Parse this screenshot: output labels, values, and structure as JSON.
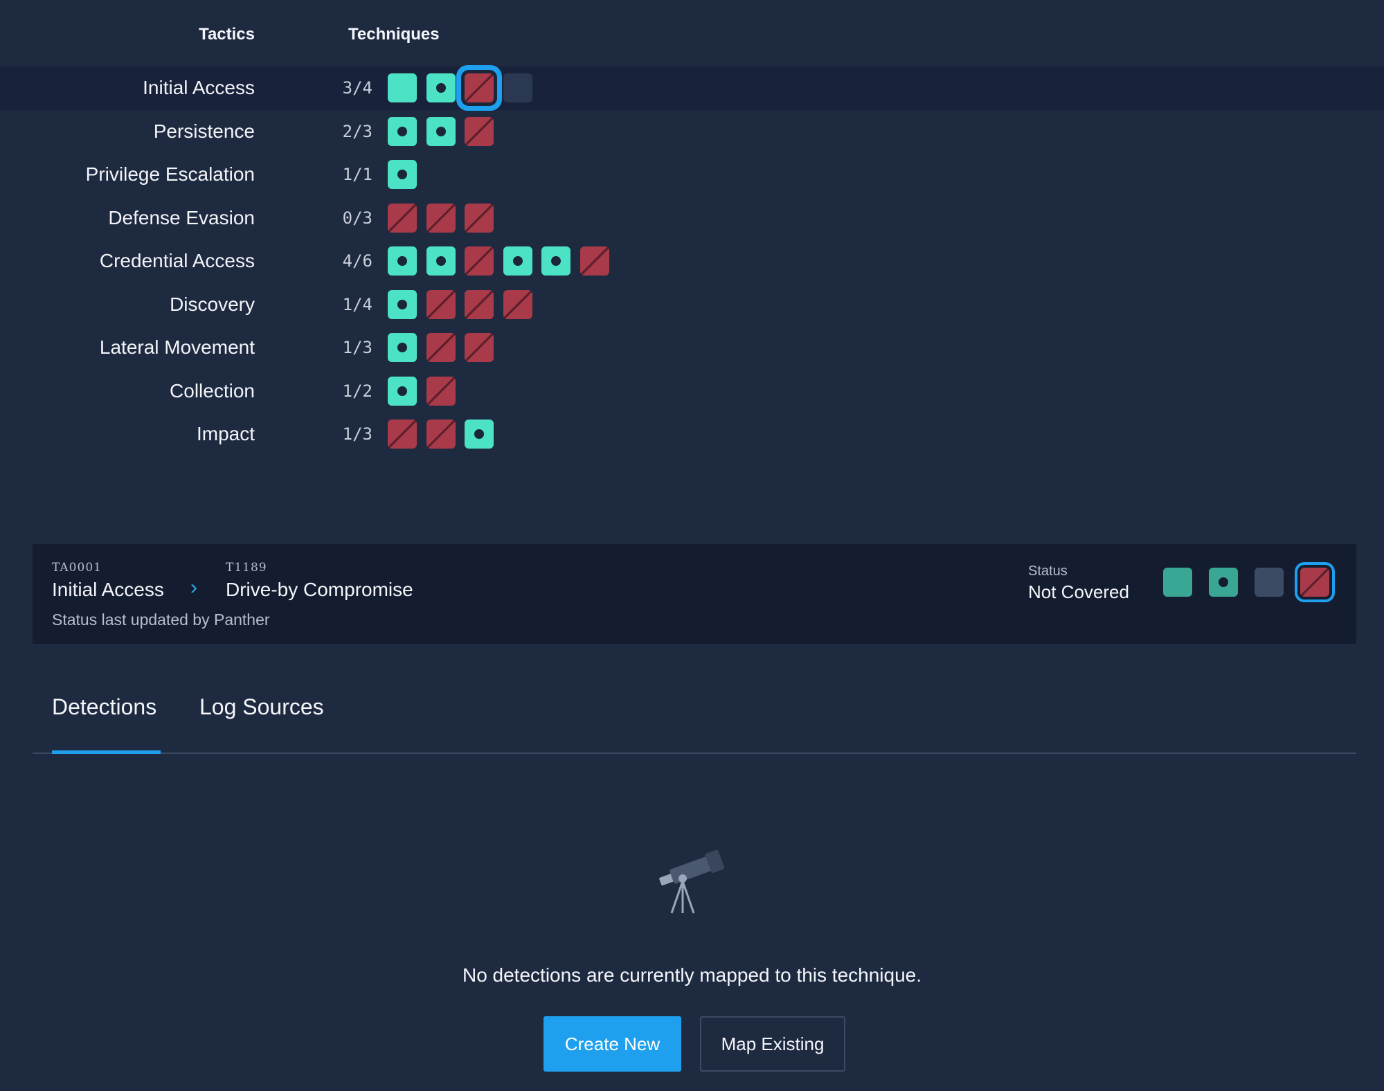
{
  "header": {
    "tactics_label": "Tactics",
    "techniques_label": "Techniques"
  },
  "colors": {
    "covered": "#4ce2c6",
    "not_covered": "#a83a4a",
    "unknown": "#3c4b64",
    "accent": "#1ea0ee",
    "background": "#1e2a40"
  },
  "tactics": [
    {
      "name": "Initial Access",
      "count": "3/4",
      "cells": [
        "covered",
        "dot",
        "none",
        "unknown"
      ],
      "selected": true,
      "focused_index": 2
    },
    {
      "name": "Persistence",
      "count": "2/3",
      "cells": [
        "dot",
        "dot",
        "none"
      ]
    },
    {
      "name": "Privilege Escalation",
      "count": "1/1",
      "cells": [
        "dot"
      ]
    },
    {
      "name": "Defense Evasion",
      "count": "0/3",
      "cells": [
        "none",
        "none",
        "none"
      ]
    },
    {
      "name": "Credential Access",
      "count": "4/6",
      "cells": [
        "dot",
        "dot",
        "none",
        "dot",
        "dot",
        "none"
      ]
    },
    {
      "name": "Discovery",
      "count": "1/4",
      "cells": [
        "dot",
        "none",
        "none",
        "none"
      ]
    },
    {
      "name": "Lateral Movement",
      "count": "1/3",
      "cells": [
        "dot",
        "none",
        "none"
      ]
    },
    {
      "name": "Collection",
      "count": "1/2",
      "cells": [
        "dot",
        "none"
      ]
    },
    {
      "name": "Impact",
      "count": "1/3",
      "cells": [
        "none",
        "none",
        "dot"
      ]
    }
  ],
  "detail": {
    "tactic_id": "TA0001",
    "tactic_name": "Initial Access",
    "technique_id": "T1189",
    "technique_name": "Drive-by Compromise",
    "updated_text": "Status last updated by Panther",
    "status_label": "Status",
    "status_value": "Not Covered",
    "chevron_icon": "chevron-right-icon"
  },
  "tabs": [
    {
      "label": "Detections",
      "active": true
    },
    {
      "label": "Log Sources",
      "active": false
    }
  ],
  "empty_state": {
    "icon": "telescope-icon",
    "message": "No detections are currently mapped to this technique."
  },
  "actions": {
    "create_label": "Create New",
    "map_label": "Map Existing"
  }
}
